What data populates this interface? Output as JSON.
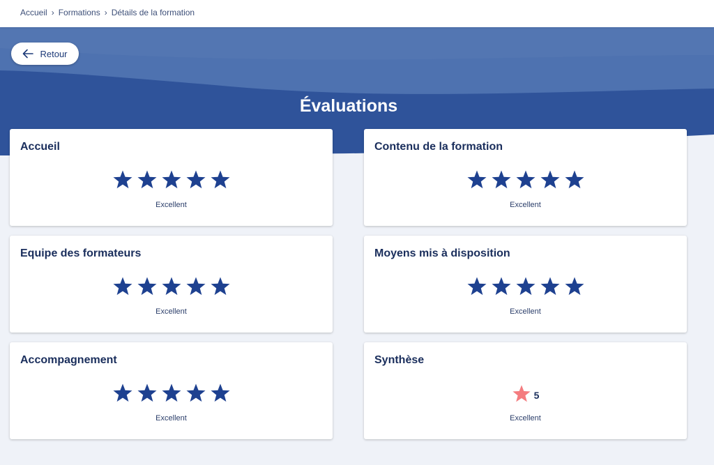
{
  "breadcrumb": {
    "items": [
      "Accueil",
      "Formations",
      "Détails de la formation"
    ]
  },
  "back_button": {
    "label": "Retour",
    "icon": "arrow-left-icon"
  },
  "page_title": "Évaluations",
  "colors": {
    "hero_dark": "#2f539a",
    "hero_light": "#4e72b0",
    "star": "#1e4190",
    "star_highlight": "#f47c7f",
    "background": "#eff2f8"
  },
  "evaluations": [
    {
      "title": "Accueil",
      "rating": 5,
      "max": 5,
      "label": "Excellent"
    },
    {
      "title": "Contenu de la formation",
      "rating": 5,
      "max": 5,
      "label": "Excellent"
    },
    {
      "title": "Equipe des formateurs",
      "rating": 5,
      "max": 5,
      "label": "Excellent"
    },
    {
      "title": "Moyens mis à disposition",
      "rating": 5,
      "max": 5,
      "label": "Excellent"
    },
    {
      "title": "Accompagnement",
      "rating": 5,
      "max": 5,
      "label": "Excellent"
    },
    {
      "title": "Synthèse",
      "score": "5",
      "label": "Excellent"
    }
  ]
}
